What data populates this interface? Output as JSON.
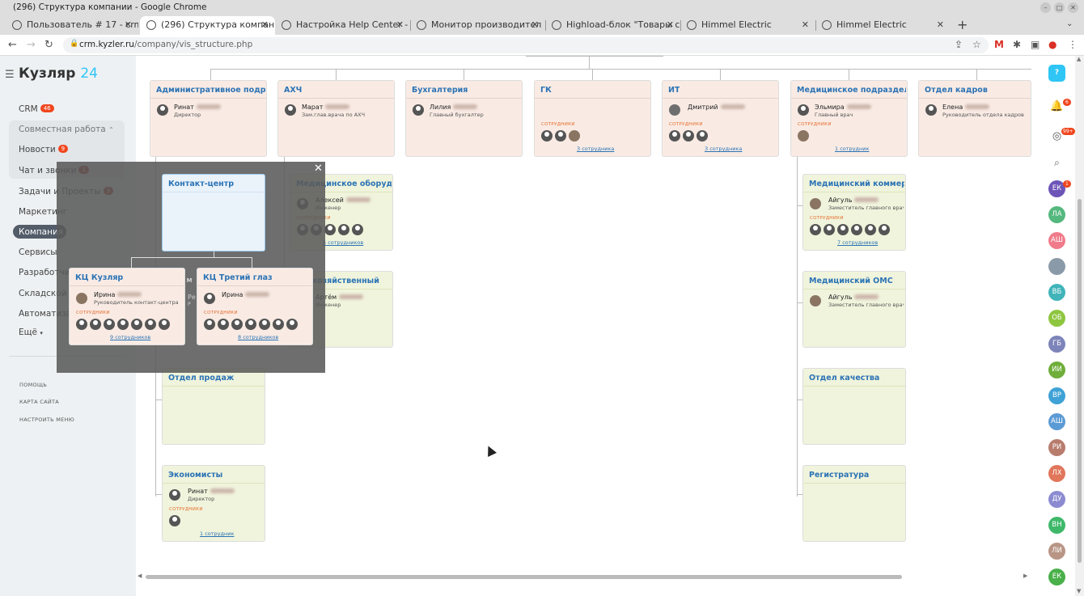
{
  "window": {
    "title": "(296) Структура компании - Google Chrome"
  },
  "tabs": [
    {
      "label": "Пользователь # 17 - crm.",
      "active": false
    },
    {
      "label": "(296) Структура компан",
      "active": true
    },
    {
      "label": "Настройка Help Center -",
      "active": false
    },
    {
      "label": "Монитор производител",
      "active": false
    },
    {
      "label": "Highload-блок \"Товары с",
      "active": false
    },
    {
      "label": "Himmel Electric",
      "active": false
    },
    {
      "label": "Himmel Electric",
      "active": false
    }
  ],
  "address": {
    "host": "crm.kyzler.ru",
    "path": "/company/vis_structure.php"
  },
  "brand": {
    "name": "Кузляр",
    "num": "24"
  },
  "menu": {
    "crm": "CRM",
    "crm_badge": "46",
    "collab": "Совместная работа",
    "news": "Новости",
    "news_badge": "9",
    "chat": "Чат и звонки",
    "chat_badge": "1",
    "tasks": "Задачи и Проекты",
    "tasks_badge": "3",
    "marketing": "Маркетинг",
    "company": "Компания",
    "services": "Сервисы",
    "dev": "Разработчи",
    "warehouse": "Складской у",
    "auto": "Автоматиза",
    "more": "Ещё",
    "help": "ПОМОЩЬ",
    "sitemap": "КАРТА САЙТА",
    "configure": "НАСТРОИТЬ МЕНЮ"
  },
  "staff_label": "СОТРУДНИКИ",
  "departments": {
    "admin": {
      "title": "Административное подраз...",
      "person": "Ринат",
      "position": "Директор"
    },
    "ahch": {
      "title": "АХЧ",
      "person": "Марат",
      "position": "Зам.глав.врача по АХЧ"
    },
    "buh": {
      "title": "Бухгалтерия",
      "person": "Лилия",
      "position": "Главный бухгалтер"
    },
    "gk": {
      "title": "ГК",
      "link": "3 сотрудника"
    },
    "it": {
      "title": "ИТ",
      "person": "Дмитрий",
      "link": "3 сотрудника"
    },
    "med": {
      "title": "Медицинское подразделение",
      "person": "Эльмира",
      "position": "Главный врач",
      "link": "1 сотрудник"
    },
    "hr": {
      "title": "Отдел кадров",
      "person": "Елена",
      "position": "Руководитель отдела кадров"
    },
    "medeq": {
      "title": "Медицинское оборудо...",
      "person": "Алексей",
      "position": "Инженер",
      "link": "5 сотрудников"
    },
    "hoz": {
      "title": "хозяйственный",
      "person": "Артём",
      "position": "Инженер"
    },
    "medcom": {
      "title": "Медицинский коммерц...",
      "person": "Айгуль",
      "position": "Заместитель главного врач...",
      "link": "7 сотрудников"
    },
    "medoms": {
      "title": "Медицинский ОМС",
      "person": "Айгуль",
      "position": "Заместитель главного врач..."
    },
    "quality": {
      "title": "Отдел качества"
    },
    "registry": {
      "title": "Регистратура"
    },
    "sales": {
      "title": "Отдел продаж"
    },
    "econ": {
      "title": "Экономисты",
      "person": "Ринат",
      "position": "Директор",
      "link": "1 сотрудник"
    },
    "hidden1_person": "Ре",
    "hidden1_pos": "Р",
    "hidden1_title": "л м"
  },
  "overlay": {
    "contact": {
      "title": "Контакт-центр"
    },
    "kc1": {
      "title": "КЦ Кузляр",
      "person": "Ирина",
      "position": "Руководитель контакт-центра",
      "link": "9 сотрудников"
    },
    "kc2": {
      "title": "КЦ Третий глаз",
      "person": "Ирина",
      "link": "8 сотрудников"
    }
  },
  "users": [
    {
      "i": "ЕК",
      "c": "#6d55b8"
    },
    {
      "i": "ЛА",
      "c": "#55b87e"
    },
    {
      "i": "АШ",
      "c": "#f07b8a"
    },
    {
      "i": "",
      "c": "#8a9aa8"
    },
    {
      "i": "ВБ",
      "c": "#40b4b9"
    },
    {
      "i": "ОБ",
      "c": "#8ec63f"
    },
    {
      "i": "ГБ",
      "c": "#7d84b9"
    },
    {
      "i": "ИИ",
      "c": "#6fae3a"
    },
    {
      "i": "ВР",
      "c": "#3fa2d6"
    },
    {
      "i": "АШ",
      "c": "#5b9bd5"
    },
    {
      "i": "РИ",
      "c": "#b87c6d"
    },
    {
      "i": "ЛХ",
      "c": "#e0765a"
    },
    {
      "i": "ДУ",
      "c": "#8c8bd1"
    },
    {
      "i": "ВН",
      "c": "#3fb86a"
    },
    {
      "i": "ЛИ",
      "c": "#b89585"
    },
    {
      "i": "ЕК",
      "c": "#4ab04a"
    }
  ],
  "notify": {
    "bell": "6",
    "chat": "99+",
    "user1": "1"
  }
}
